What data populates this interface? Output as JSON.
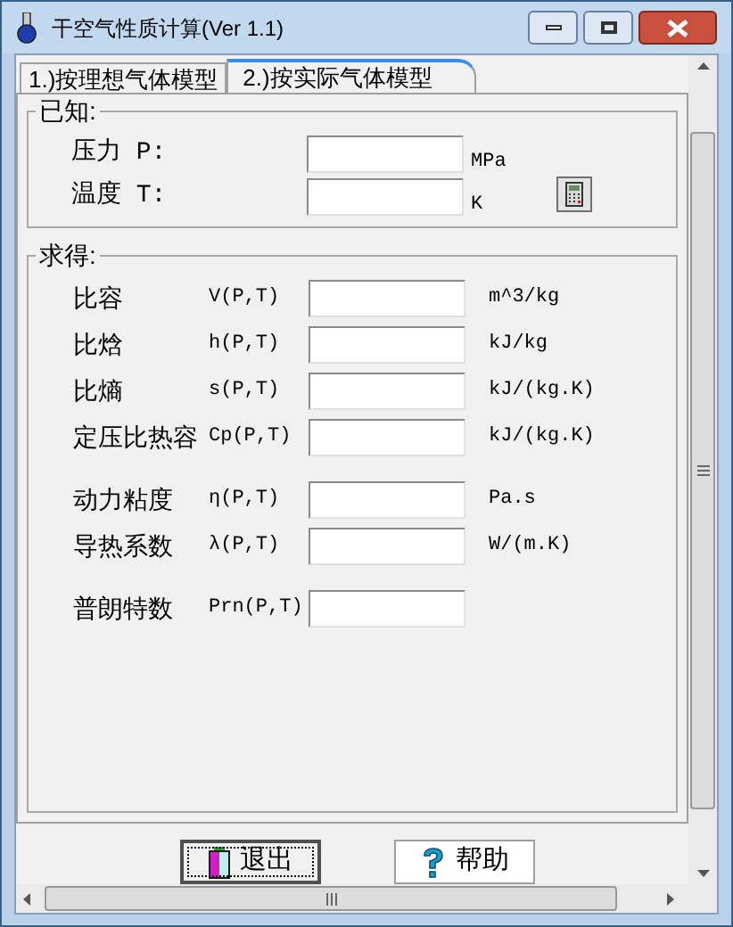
{
  "window": {
    "title": "干空气性质计算(Ver 1.1)"
  },
  "tabs": [
    {
      "label": "1.)按理想气体模型",
      "selected": false
    },
    {
      "label": "2.)按实际气体模型",
      "selected": true
    }
  ],
  "known": {
    "title": "已知:",
    "fields": [
      {
        "label": "压力 P:",
        "unit": "MPa"
      },
      {
        "label": "温度 T:",
        "unit": "K"
      }
    ]
  },
  "results": {
    "title": "求得:",
    "groups": [
      [
        {
          "label": "比容",
          "symbol": "V(P,T)",
          "unit": "m^3/kg"
        },
        {
          "label": "比焓",
          "symbol": "h(P,T)",
          "unit": "kJ/kg"
        },
        {
          "label": "比熵",
          "symbol": "s(P,T)",
          "unit": "kJ/(kg.K)"
        },
        {
          "label": "定压比热容",
          "symbol": "Cp(P,T)",
          "unit": "kJ/(kg.K)"
        }
      ],
      [
        {
          "label": "动力粘度",
          "symbol": "η(P,T)",
          "unit": "Pa.s"
        },
        {
          "label": "导热系数",
          "symbol": "λ(P,T)",
          "unit": "W/(m.K)"
        }
      ],
      [
        {
          "label": "普朗特数",
          "symbol": "Prn(P,T)"
        }
      ]
    ]
  },
  "buttons": [
    {
      "label": "退出",
      "kind": "exit",
      "focused": true
    },
    {
      "label": "帮助",
      "kind": "help",
      "focused": false
    }
  ]
}
